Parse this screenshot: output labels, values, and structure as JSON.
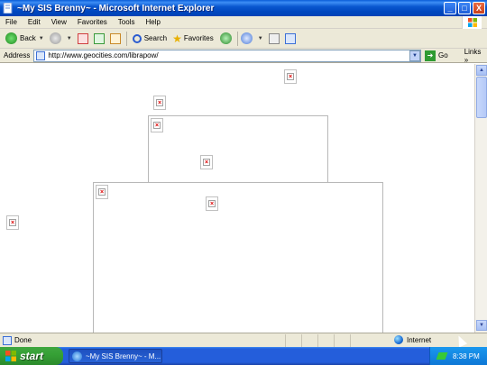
{
  "window": {
    "title": "~My SIS Brenny~ - Microsoft Internet Explorer",
    "buttons": {
      "minimize": "_",
      "maximize": "□",
      "close": "X"
    }
  },
  "menu": [
    "File",
    "Edit",
    "View",
    "Favorites",
    "Tools",
    "Help"
  ],
  "toolbar": {
    "back": "Back",
    "search": "Search",
    "favorites": "Favorites"
  },
  "address": {
    "label": "Address",
    "url": "http://www.geocities.com/librapow/",
    "go": "Go",
    "links": "Links"
  },
  "status": {
    "text": "Done",
    "zone": "Internet"
  },
  "taskbar": {
    "start": "start",
    "task": "~My SIS Brenny~ - M...",
    "clock": "8:38 PM"
  },
  "colors": {
    "titlebar": "#0a58d0",
    "chrome": "#ece9d8",
    "taskbar": "#245edb",
    "start": "#36a136"
  }
}
